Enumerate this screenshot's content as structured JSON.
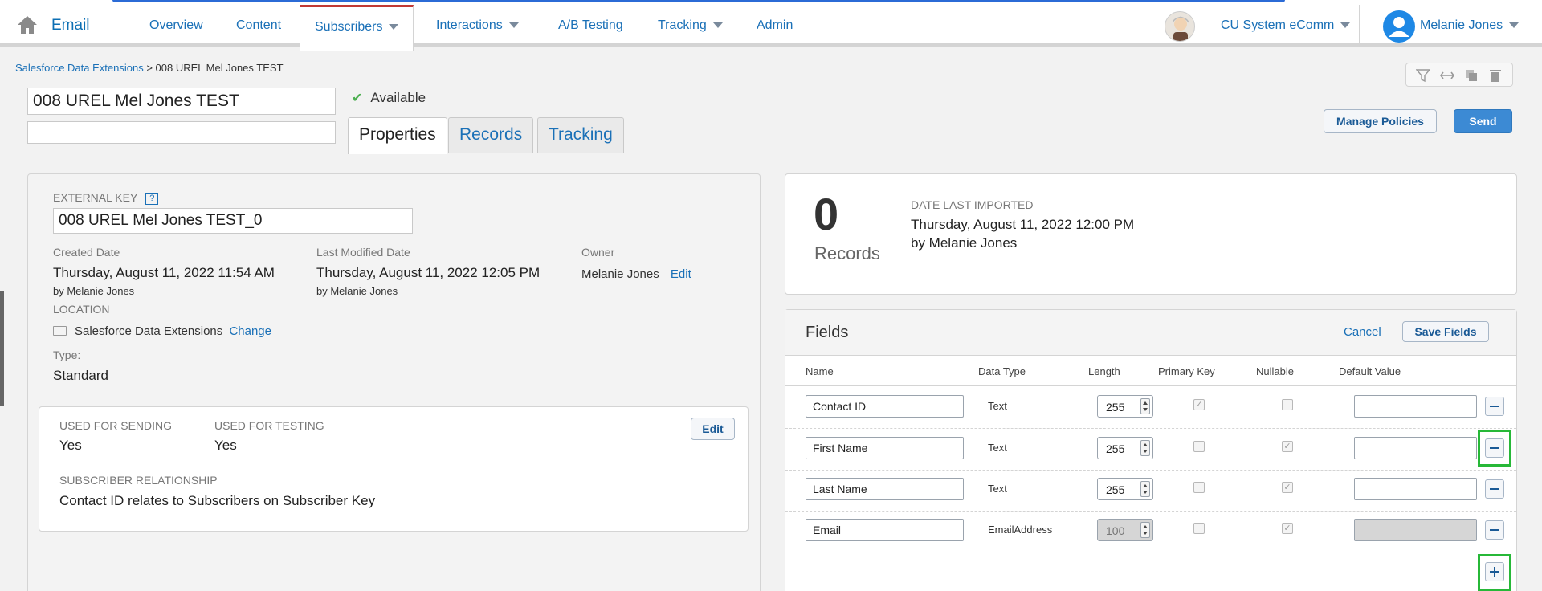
{
  "nav": {
    "app_title": "Email",
    "items": [
      "Overview",
      "Content",
      "Subscribers",
      "Interactions",
      "A/B Testing",
      "Tracking",
      "Admin"
    ],
    "business_unit": "CU System eComm",
    "user_name": "Melanie Jones"
  },
  "breadcrumb": {
    "parent": "Salesforce Data Extensions",
    "separator": ">",
    "current": "008 UREL Mel Jones TEST"
  },
  "header": {
    "name_value": "008 UREL Mel Jones TEST",
    "description_value": "",
    "status": "Available",
    "tabs": [
      "Properties",
      "Records",
      "Tracking"
    ],
    "manage_policies_label": "Manage Policies",
    "send_label": "Send"
  },
  "properties": {
    "external_key_label": "EXTERNAL KEY",
    "help_label": "?",
    "external_key_value": "008 UREL Mel Jones TEST_0",
    "created_label": "Created Date",
    "created_value": "Thursday, August 11, 2022 11:54 AM",
    "created_by": "by Melanie Jones",
    "modified_label": "Last Modified Date",
    "modified_value": "Thursday, August 11, 2022 12:05 PM",
    "modified_by": "by Melanie Jones",
    "owner_label": "Owner",
    "owner_value": "Melanie Jones",
    "owner_edit": "Edit",
    "location_label": "LOCATION",
    "location_value": "Salesforce Data Extensions",
    "location_change": "Change",
    "type_label": "Type:",
    "type_value": "Standard",
    "sending_label": "USED FOR SENDING",
    "sending_value": "Yes",
    "testing_label": "USED FOR TESTING",
    "testing_value": "Yes",
    "edit_label": "Edit",
    "relationship_label": "SUBSCRIBER RELATIONSHIP",
    "relationship_value": "Contact ID relates to Subscribers on Subscriber Key"
  },
  "records": {
    "count": "0",
    "label": "Records",
    "imported_label": "DATE LAST IMPORTED",
    "imported_value": "Thursday, August 11, 2022 12:00 PM",
    "imported_by": "by Melanie Jones"
  },
  "fields": {
    "title": "Fields",
    "cancel_label": "Cancel",
    "save_label": "Save Fields",
    "columns": [
      "Name",
      "Data Type",
      "Length",
      "Primary Key",
      "Nullable",
      "Default Value"
    ],
    "rows": [
      {
        "name": "Contact ID",
        "type": "Text",
        "length": "255",
        "primary_key": true,
        "nullable": false,
        "default": ""
      },
      {
        "name": "First Name",
        "type": "Text",
        "length": "255",
        "primary_key": false,
        "nullable": true,
        "default": ""
      },
      {
        "name": "Last Name",
        "type": "Text",
        "length": "255",
        "primary_key": false,
        "nullable": true,
        "default": ""
      },
      {
        "name": "Email",
        "type": "EmailAddress",
        "length": "100",
        "primary_key": false,
        "nullable": true,
        "default": ""
      }
    ]
  },
  "colors": {
    "accent": "#1a70b7",
    "active_tab_border": "#c23934",
    "highlight": "#27b838",
    "send_button": "#3c8ad4"
  }
}
